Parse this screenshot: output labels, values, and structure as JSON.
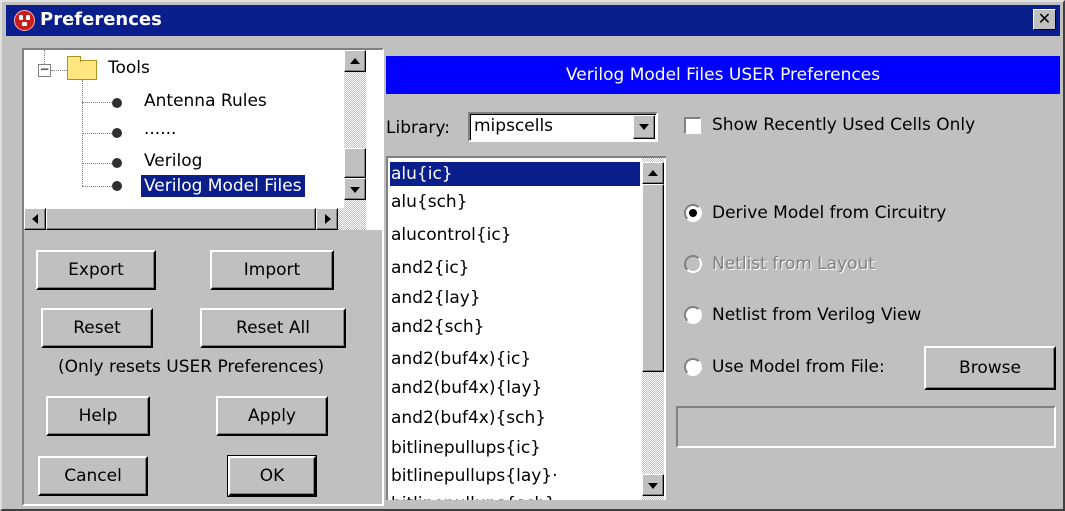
{
  "window": {
    "title": "Preferences",
    "close_symbol": "✕"
  },
  "tree": {
    "root": {
      "label": "Tools",
      "expander": "−"
    },
    "items": [
      {
        "label": "Antenna Rules"
      },
      {
        "label": "......"
      },
      {
        "label": "Verilog"
      },
      {
        "label": "Verilog Model Files",
        "selected": true
      }
    ]
  },
  "buttons": {
    "export": "Export",
    "import": "Import",
    "reset": "Reset",
    "reset_all": "Reset All",
    "reset_note": "(Only resets USER Preferences)",
    "help": "Help",
    "apply": "Apply",
    "cancel": "Cancel",
    "ok": "OK"
  },
  "panel": {
    "header": "Verilog Model Files USER Preferences",
    "library_label": "Library:",
    "library_value": "mipscells",
    "show_recent_label": "Show Recently Used Cells Only",
    "show_recent_checked": false,
    "cells": [
      "alu{ic}",
      "alu{sch}",
      "alucontrol{ic}",
      "and2{ic}",
      "and2{lay}",
      "and2{sch}",
      "and2(buf4x){ic}",
      "and2(buf4x){lay}",
      "and2(buf4x){sch}",
      "bitlinepullups{ic}",
      "bitlinepullups{lay}·",
      "bitlinepullups{sch}"
    ],
    "selected_cell": "alu{ic}",
    "options": [
      {
        "label": "Derive Model from Circuitry",
        "selected": true,
        "enabled": true
      },
      {
        "label": "Netlist from Layout",
        "selected": false,
        "enabled": false
      },
      {
        "label": "Netlist from Verilog View",
        "selected": false,
        "enabled": true
      },
      {
        "label": "Use Model from File:",
        "selected": false,
        "enabled": true
      }
    ],
    "browse": "Browse",
    "file_path": ""
  },
  "colors": {
    "title_bar": "#0a1e8c",
    "header_bar": "#0000ff",
    "selection": "#0a1e8c",
    "face": "#c0c0c0"
  }
}
